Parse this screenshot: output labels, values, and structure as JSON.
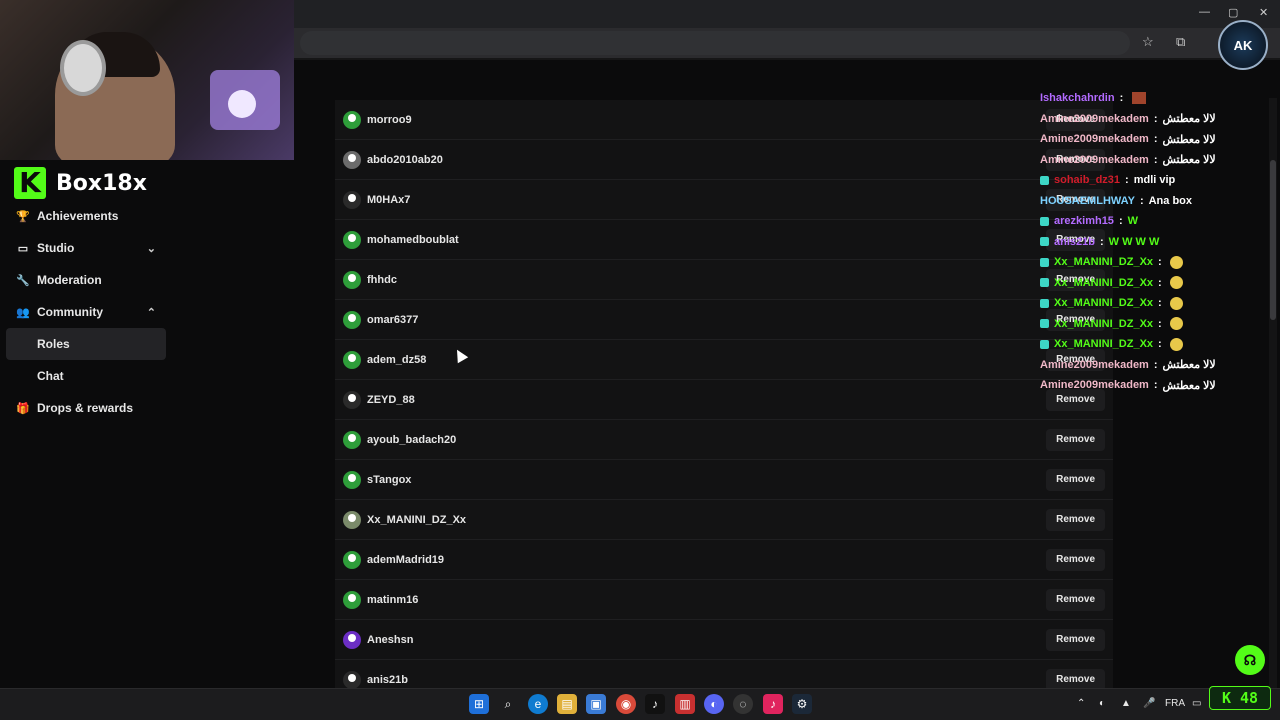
{
  "browser": {
    "window_controls": [
      "—",
      "▢",
      "✕"
    ]
  },
  "brand": {
    "logo_letter": "K",
    "channel_name": "Box18x",
    "accent_color": "#53fc18"
  },
  "sidebar": {
    "items": [
      {
        "label": "Achievements",
        "icon": "trophy-icon"
      },
      {
        "label": "Studio",
        "icon": "monitor-icon",
        "chevron": "down"
      },
      {
        "label": "Moderation",
        "icon": "wrench-icon"
      },
      {
        "label": "Community",
        "icon": "community-icon",
        "chevron": "up"
      },
      {
        "label": "Roles",
        "sub": true,
        "active": true
      },
      {
        "label": "Chat",
        "sub": true
      },
      {
        "label": "Drops & rewards",
        "icon": "gift-icon"
      }
    ]
  },
  "roles_list": {
    "remove_label": "Remove",
    "users": [
      {
        "name": "morroo9",
        "avatar": "green"
      },
      {
        "name": "abdo2010ab20",
        "avatar": "grey"
      },
      {
        "name": "M0HAx7",
        "avatar": "dark"
      },
      {
        "name": "mohamedboublat",
        "avatar": "green"
      },
      {
        "name": "fhhdc",
        "avatar": "green"
      },
      {
        "name": "omar6377",
        "avatar": "green"
      },
      {
        "name": "adem_dz58",
        "avatar": "green"
      },
      {
        "name": "ZEYD_88",
        "avatar": "dark"
      },
      {
        "name": "ayoub_badach20",
        "avatar": "green"
      },
      {
        "name": "sTangox",
        "avatar": "green"
      },
      {
        "name": "Xx_MANINI_DZ_Xx",
        "avatar": "mix"
      },
      {
        "name": "ademMadrid19",
        "avatar": "green"
      },
      {
        "name": "matinm16",
        "avatar": "green"
      },
      {
        "name": "Aneshsn",
        "avatar": "purple"
      },
      {
        "name": "anis21b",
        "avatar": "dark"
      }
    ]
  },
  "chat": {
    "messages": [
      {
        "user": "Ishakchahrdin",
        "color": "#b36bff",
        "text": "",
        "badge": false,
        "extra": "brick"
      },
      {
        "user": "Amine2009mekadem",
        "color": "#f0b8c8",
        "text": "لالا معطتش",
        "badge": false
      },
      {
        "user": "Amine2009mekadem",
        "color": "#f0b8c8",
        "text": "لالا معطتش",
        "badge": false
      },
      {
        "user": "Amine2009mekadem",
        "color": "#f0b8c8",
        "text": "لالا معطتش",
        "badge": false
      },
      {
        "user": "sohaib_dz31",
        "color": "#d01c2a",
        "text": "mdli vip",
        "badge": true
      },
      {
        "user": "HOUSAEMLHWAY",
        "color": "#7ed2ff",
        "text": "Ana box",
        "badge": false
      },
      {
        "user": "arezkimh15",
        "color": "#b36bff",
        "text": "W",
        "badge": true,
        "text_color": "#53fc18"
      },
      {
        "user": "anis21b",
        "color": "#b36bff",
        "text": "W  W  W  W",
        "badge": true,
        "text_color": "#53fc18"
      },
      {
        "user": "Xx_MANINI_DZ_Xx",
        "color": "#53fc18",
        "text": "",
        "badge": true,
        "extra": "emote"
      },
      {
        "user": "Xx_MANINI_DZ_Xx",
        "color": "#53fc18",
        "text": "",
        "badge": true,
        "extra": "emote"
      },
      {
        "user": "Xx_MANINI_DZ_Xx",
        "color": "#53fc18",
        "text": "",
        "badge": true,
        "extra": "emote"
      },
      {
        "user": "Xx_MANINI_DZ_Xx",
        "color": "#53fc18",
        "text": "",
        "badge": true,
        "extra": "emote"
      },
      {
        "user": "Xx_MANINI_DZ_Xx",
        "color": "#53fc18",
        "text": "",
        "badge": true,
        "extra": "emote"
      },
      {
        "user": "Amine2009mekadem",
        "color": "#f0b8c8",
        "text": "لالا معطتش",
        "badge": false
      },
      {
        "user": "Amine2009mekadem",
        "color": "#f0b8c8",
        "text": "لالا معطتش",
        "badge": false
      }
    ]
  },
  "overlay": {
    "ak_logo_text": "AK",
    "viewer_counter": "48",
    "help_icon": "headset-icon"
  },
  "taskbar": {
    "language": "FRA"
  }
}
